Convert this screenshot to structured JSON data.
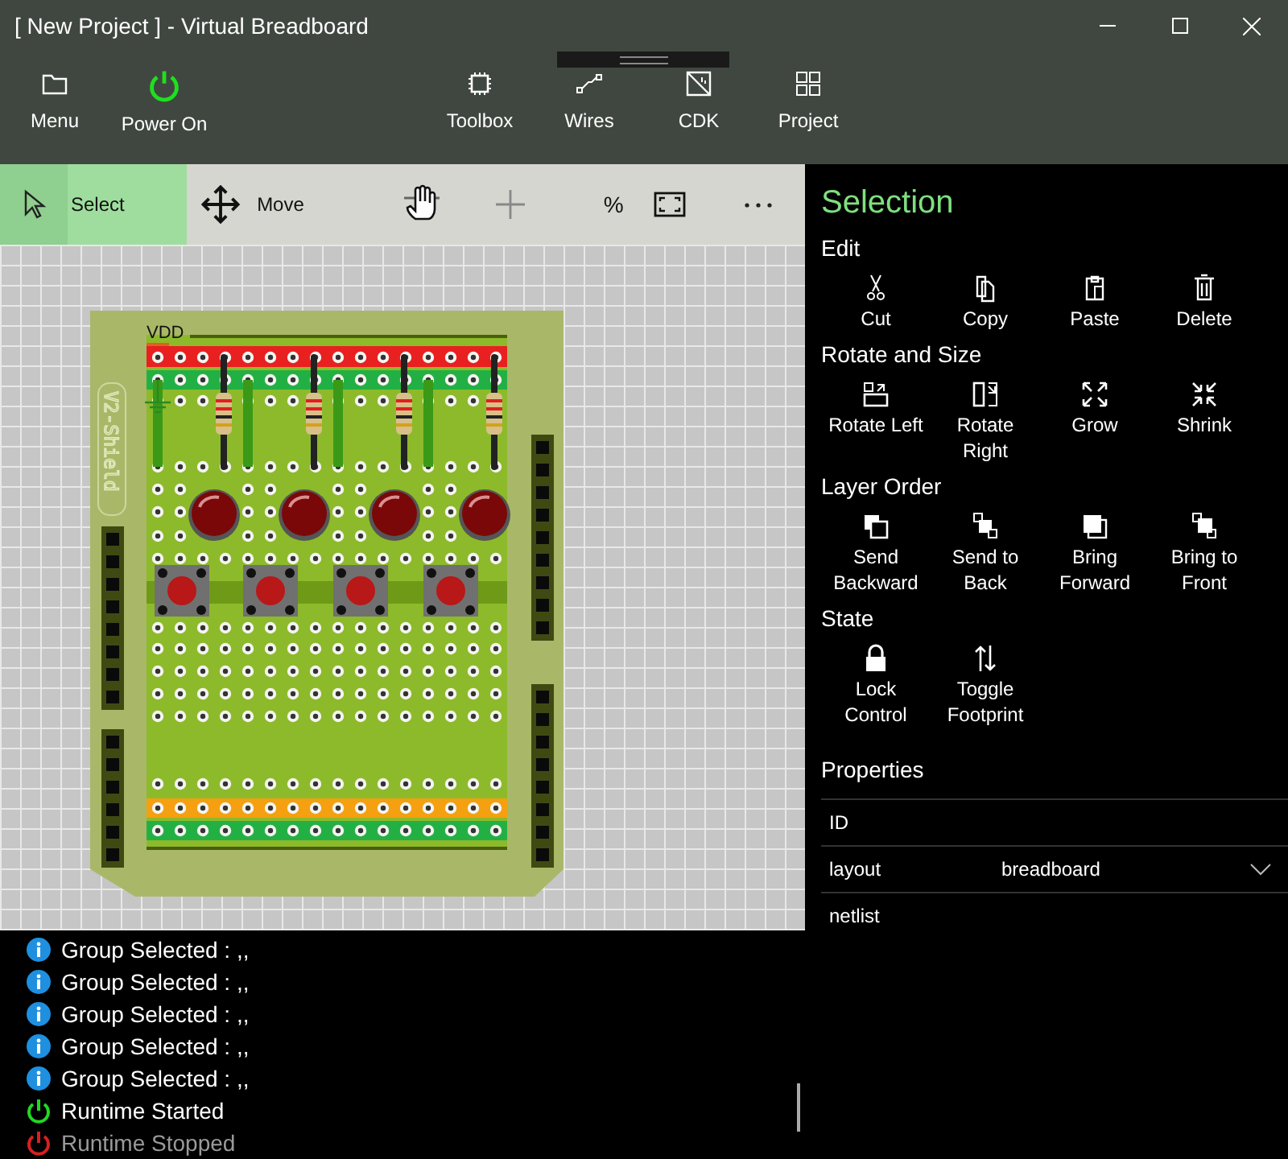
{
  "window": {
    "title": "[ New Project ] - Virtual Breadboard"
  },
  "toolbar": [
    {
      "kind": "menu",
      "label": "Menu"
    },
    {
      "kind": "power",
      "label": "Power On",
      "on": true
    },
    {
      "kind": "toolbox",
      "label": "Toolbox"
    },
    {
      "kind": "wires",
      "label": "Wires"
    },
    {
      "kind": "cdk",
      "label": "CDK"
    },
    {
      "kind": "project",
      "label": "Project"
    }
  ],
  "tools": [
    {
      "kind": "select",
      "label": "Select",
      "selected": true
    },
    {
      "kind": "move",
      "label": "Move",
      "selected": false
    },
    {
      "kind": "pan"
    },
    {
      "kind": "add"
    },
    {
      "kind": "zoom",
      "label": "%"
    },
    {
      "kind": "fit"
    },
    {
      "kind": "more"
    }
  ],
  "board": {
    "rail_label": "VDD",
    "silkscreen": "V2-Shield"
  },
  "selection": {
    "title": "Selection",
    "sections": [
      {
        "label": "Edit",
        "items": [
          {
            "kind": "cut",
            "lines": [
              "Cut"
            ]
          },
          {
            "kind": "copy",
            "lines": [
              "Copy"
            ]
          },
          {
            "kind": "paste",
            "lines": [
              "Paste"
            ]
          },
          {
            "kind": "delete",
            "lines": [
              "Delete"
            ]
          }
        ]
      },
      {
        "label": "Rotate and Size",
        "items": [
          {
            "kind": "rotate-left",
            "lines": [
              "Rotate Left"
            ]
          },
          {
            "kind": "rotate-right",
            "lines": [
              "Rotate",
              "Right"
            ]
          },
          {
            "kind": "grow",
            "lines": [
              "Grow"
            ]
          },
          {
            "kind": "shrink",
            "lines": [
              "Shrink"
            ]
          }
        ]
      },
      {
        "label": "Layer Order",
        "items": [
          {
            "kind": "send-backward",
            "lines": [
              "Send",
              "Backward"
            ]
          },
          {
            "kind": "send-back",
            "lines": [
              "Send to",
              "Back"
            ]
          },
          {
            "kind": "bring-forward",
            "lines": [
              "Bring",
              "Forward"
            ]
          },
          {
            "kind": "bring-front",
            "lines": [
              "Bring to",
              "Front"
            ]
          }
        ]
      },
      {
        "label": "State",
        "items": [
          {
            "kind": "lock",
            "lines": [
              "Lock",
              "Control"
            ]
          },
          {
            "kind": "footprint",
            "lines": [
              "Toggle",
              "Footprint"
            ]
          }
        ]
      }
    ],
    "properties_title": "Properties",
    "properties": [
      {
        "name": "ID"
      },
      {
        "name": "layout",
        "kind": "dropdown",
        "value": "breadboard"
      },
      {
        "name": "netlist"
      }
    ]
  },
  "log": [
    {
      "kind": "info",
      "text": "Group Selected : ,,"
    },
    {
      "kind": "info",
      "text": "Group Selected : ,,"
    },
    {
      "kind": "info",
      "text": "Group Selected : ,,"
    },
    {
      "kind": "info",
      "text": "Group Selected : ,,"
    },
    {
      "kind": "info",
      "text": "Group Selected : ,,"
    },
    {
      "kind": "started",
      "text": "Runtime Started"
    },
    {
      "kind": "stopped",
      "text": "Runtime Stopped"
    }
  ]
}
